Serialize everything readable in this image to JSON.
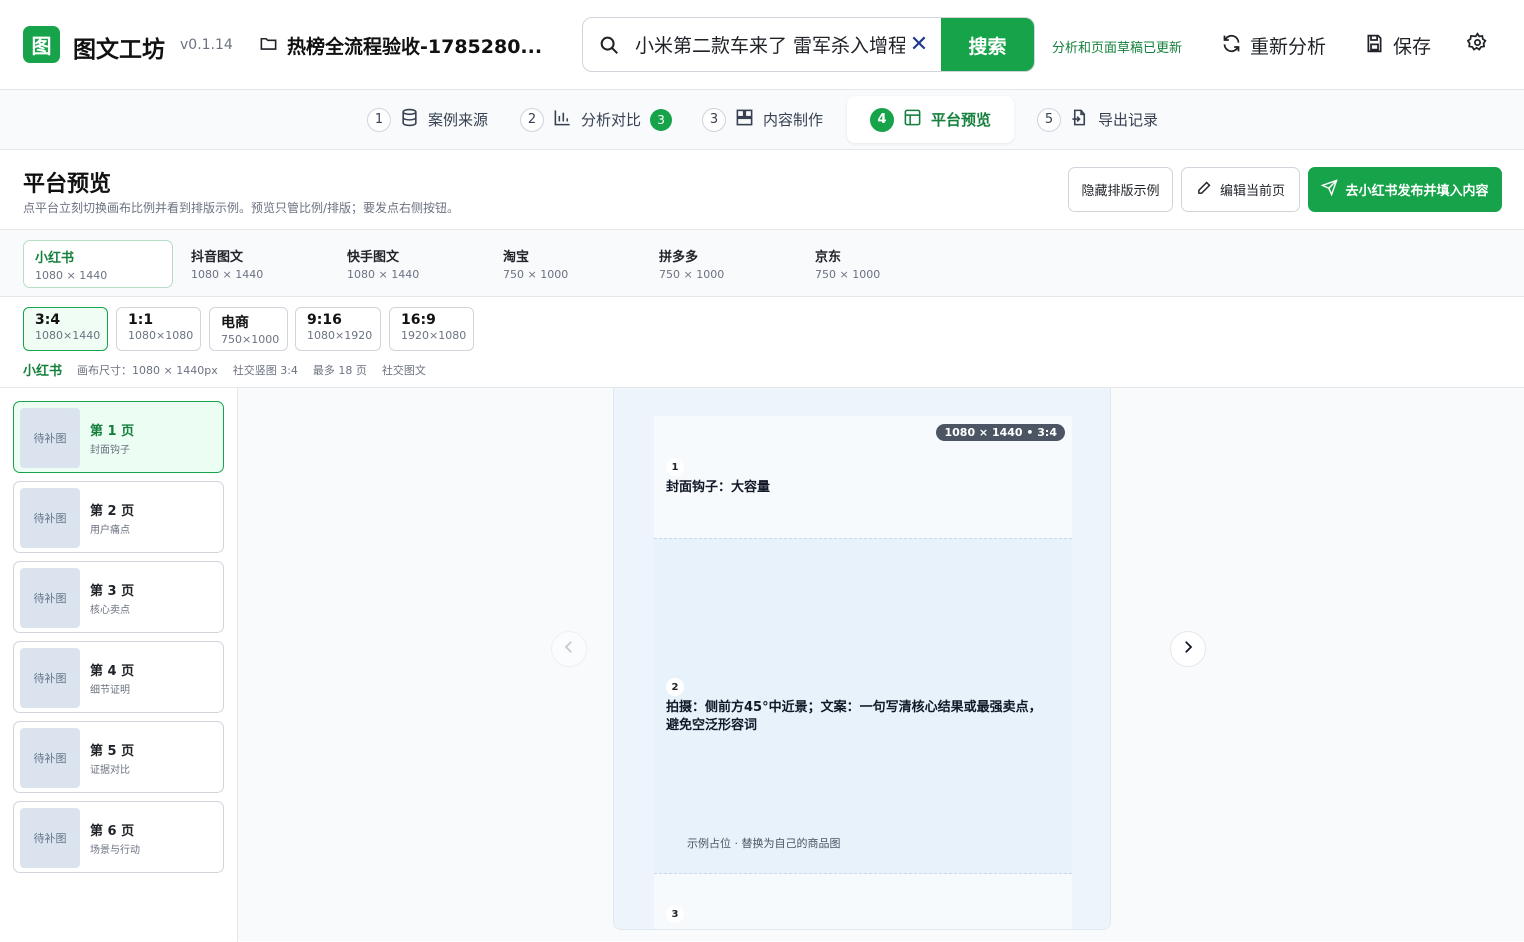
{
  "header": {
    "logo_char": "图",
    "app_name": "图文工坊",
    "version": "v0.1.14",
    "project_title": "热榜全流程验收-1785280...",
    "search_value": "小米第二款车来了 雷军杀入增程",
    "search_button": "搜索",
    "status_text": "分析和页面草稿已更新",
    "reanalyze": "重新分析",
    "save": "保存"
  },
  "steps": [
    {
      "num": "1",
      "label": "案例来源"
    },
    {
      "num": "2",
      "label": "分析对比",
      "badge": "3"
    },
    {
      "num": "3",
      "label": "内容制作"
    },
    {
      "num": "4",
      "label": "平台预览"
    },
    {
      "num": "5",
      "label": "导出记录"
    }
  ],
  "section": {
    "title": "平台预览",
    "desc": "点平台立刻切换画布比例并看到排版示例。预览只管比例/排版；要发点右侧按钮。",
    "hide_examples": "隐藏排版示例",
    "edit_page": "编辑当前页",
    "publish": "去小红书发布并填入内容"
  },
  "platforms": [
    {
      "name": "小红书",
      "size": "1080 × 1440"
    },
    {
      "name": "抖音图文",
      "size": "1080 × 1440"
    },
    {
      "name": "快手图文",
      "size": "1080 × 1440"
    },
    {
      "name": "淘宝",
      "size": "750 × 1000"
    },
    {
      "name": "拼多多",
      "size": "750 × 1000"
    },
    {
      "name": "京东",
      "size": "750 × 1000"
    }
  ],
  "ratios": [
    {
      "name": "3:4",
      "size": "1080×1440"
    },
    {
      "name": "1:1",
      "size": "1080×1080"
    },
    {
      "name": "电商",
      "size": "750×1000"
    },
    {
      "name": "9:16",
      "size": "1080×1920"
    },
    {
      "name": "16:9",
      "size": "1920×1080"
    }
  ],
  "meta": {
    "platform": "小红书",
    "canvas_size": "画布尺寸：1080 × 1440px",
    "format": "社交竖图 3:4",
    "max_pages": "最多 18 页",
    "kind": "社交图文"
  },
  "pages": [
    {
      "thumb": "待补图",
      "title": "第 1 页",
      "desc": "封面钩子"
    },
    {
      "thumb": "待补图",
      "title": "第 2 页",
      "desc": "用户痛点"
    },
    {
      "thumb": "待补图",
      "title": "第 3 页",
      "desc": "核心卖点"
    },
    {
      "thumb": "待补图",
      "title": "第 4 页",
      "desc": "细节证明"
    },
    {
      "thumb": "待补图",
      "title": "第 5 页",
      "desc": "证据对比"
    },
    {
      "thumb": "待补图",
      "title": "第 6 页",
      "desc": "场景与行动"
    }
  ],
  "canvas": {
    "dim_badge": "1080 × 1440 • 3:4",
    "block1_num": "1",
    "block1_text": "封面钩子：大容量",
    "block2_num": "2",
    "block2_text": "拍摄：侧前方45°中近景；文案：一句写清核心结果或最强卖点，避免空泛形容词",
    "placeholder_note": "示例占位 · 替换为自己的商品图",
    "block3_num": "3"
  },
  "colors": {
    "accent": "#16a34a",
    "accent_dark": "#15803d"
  }
}
